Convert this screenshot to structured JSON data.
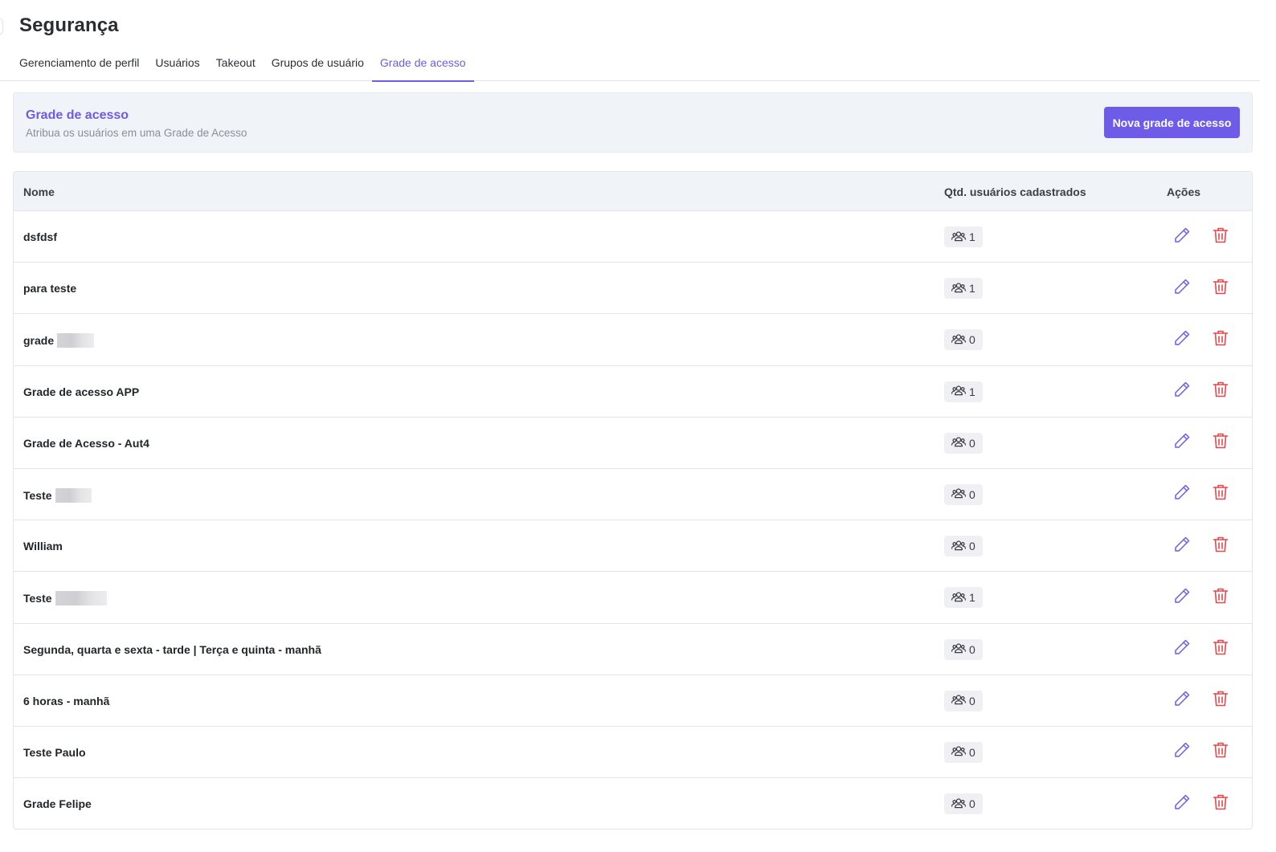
{
  "page": {
    "title": "Segurança"
  },
  "tabs": [
    {
      "label": "Gerenciamento de perfil",
      "active": false
    },
    {
      "label": "Usuários",
      "active": false
    },
    {
      "label": "Takeout",
      "active": false
    },
    {
      "label": "Grupos de usuário",
      "active": false
    },
    {
      "label": "Grade de acesso",
      "active": true
    }
  ],
  "banner": {
    "title": "Grade de acesso",
    "subtitle": "Atribua os usuários em uma Grade de Acesso",
    "button_label": "Nova grade de acesso"
  },
  "table": {
    "columns": {
      "name": "Nome",
      "qty": "Qtd. usuários cadastrados",
      "actions": "Ações"
    },
    "rows": [
      {
        "name": "dsfdsf",
        "count": "1",
        "redacted": false
      },
      {
        "name": "para teste",
        "count": "1",
        "redacted": false
      },
      {
        "name": "grade",
        "count": "0",
        "redacted": true
      },
      {
        "name": "Grade de acesso APP",
        "count": "1",
        "redacted": false
      },
      {
        "name": "Grade de Acesso - Aut4",
        "count": "0",
        "redacted": false
      },
      {
        "name": "Teste",
        "count": "0",
        "redacted": true
      },
      {
        "name": "William",
        "count": "0",
        "redacted": false
      },
      {
        "name": "Teste",
        "count": "1",
        "redacted": true
      },
      {
        "name": "Segunda, quarta e sexta - tarde | Terça e quinta - manhã",
        "count": "0",
        "redacted": false
      },
      {
        "name": "6 horas - manhã",
        "count": "0",
        "redacted": false
      },
      {
        "name": "Teste Paulo",
        "count": "0",
        "redacted": false
      },
      {
        "name": "Grade Felipe",
        "count": "0",
        "redacted": false
      }
    ]
  },
  "icons": {
    "users": "users-icon",
    "edit": "pencil-icon",
    "delete": "trash-icon"
  },
  "colors": {
    "accent": "#6c5ce7",
    "danger": "#e5484d",
    "banner_bg": "#f0f3f8"
  }
}
